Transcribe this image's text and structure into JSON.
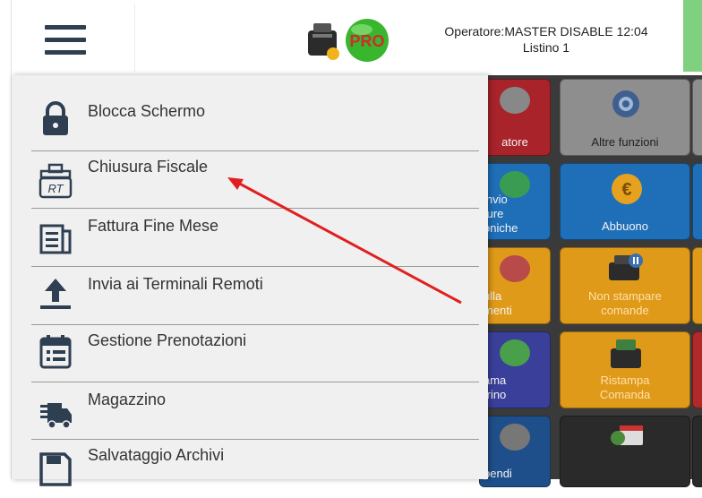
{
  "header": {
    "operator_line": "Operatore:MASTER DISABLE  12:04",
    "listino_line": "Listino 1",
    "logo_text": "PRO"
  },
  "menu": {
    "items": [
      {
        "label": "Blocca Schermo",
        "icon": "lock-icon"
      },
      {
        "label": "Chiusura Fiscale",
        "icon": "rt-printer-icon"
      },
      {
        "label": "Fattura Fine Mese",
        "icon": "document-icon"
      },
      {
        "label": "Invia ai Terminali Remoti",
        "icon": "upload-icon"
      },
      {
        "label": "Gestione Prenotazioni",
        "icon": "calendar-icon"
      },
      {
        "label": "Magazzino",
        "icon": "truck-icon"
      },
      {
        "label": "Salvataggio Archivi",
        "icon": "save-icon"
      }
    ]
  },
  "tiles": {
    "t1": "atore",
    "t2": "Altre funzioni",
    "t3": "invio\nture\noniche",
    "t4": "Abbuono",
    "t5": "ulla\nmenti",
    "t6": "Non stampare\ncomande",
    "t7": "ama\ntrino",
    "t8": "Ristampa\nComanda",
    "t9": "pendi"
  },
  "colors": {
    "icon_color": "#2f3f52",
    "annotation_arrow": "#e02020",
    "status_green": "#7fd17f"
  }
}
